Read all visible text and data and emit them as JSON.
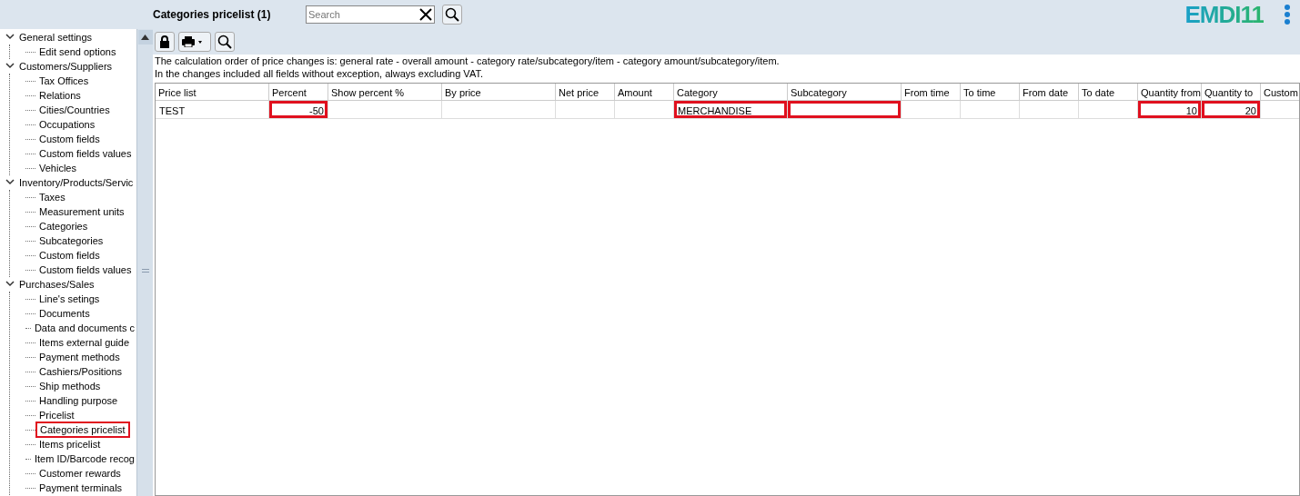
{
  "header": {
    "title": "Categories pricelist (1)",
    "search": {
      "placeholder": "Search"
    },
    "logo": "EMDI11"
  },
  "tree": [
    {
      "label": "General settings",
      "expanded": true,
      "children": [
        {
          "label": "Edit send options",
          "highlighted": false
        }
      ]
    },
    {
      "label": "Customers/Suppliers",
      "expanded": true,
      "children": [
        {
          "label": "Tax Offices",
          "highlighted": false
        },
        {
          "label": "Relations",
          "highlighted": false
        },
        {
          "label": "Cities/Countries",
          "highlighted": false
        },
        {
          "label": "Occupations",
          "highlighted": false
        },
        {
          "label": "Custom fields",
          "highlighted": false
        },
        {
          "label": "Custom fields values",
          "highlighted": false
        },
        {
          "label": "Vehicles",
          "highlighted": false
        }
      ]
    },
    {
      "label": "Inventory/Products/Servic",
      "expanded": true,
      "children": [
        {
          "label": "Taxes",
          "highlighted": false
        },
        {
          "label": "Measurement units",
          "highlighted": false
        },
        {
          "label": "Categories",
          "highlighted": false
        },
        {
          "label": "Subcategories",
          "highlighted": false
        },
        {
          "label": "Custom fields",
          "highlighted": false
        },
        {
          "label": "Custom fields values",
          "highlighted": false
        }
      ]
    },
    {
      "label": "Purchases/Sales",
      "expanded": true,
      "children": [
        {
          "label": "Line's setings",
          "highlighted": false
        },
        {
          "label": "Documents",
          "highlighted": false
        },
        {
          "label": "Data and documents c",
          "highlighted": false
        },
        {
          "label": "Items external guide",
          "highlighted": false
        },
        {
          "label": "Payment methods",
          "highlighted": false
        },
        {
          "label": "Cashiers/Positions",
          "highlighted": false
        },
        {
          "label": "Ship methods",
          "highlighted": false
        },
        {
          "label": "Handling purpose",
          "highlighted": false
        },
        {
          "label": "Pricelist",
          "highlighted": false
        },
        {
          "label": "Categories pricelist",
          "highlighted": true
        },
        {
          "label": "Items pricelist",
          "highlighted": false
        },
        {
          "label": "Item ID/Barcode recog",
          "highlighted": false
        },
        {
          "label": "Customer rewards",
          "highlighted": false
        },
        {
          "label": "Payment terminals",
          "highlighted": false
        }
      ]
    }
  ],
  "notes": [
    "The calculation order of price changes  is: general rate - overall amount - category rate/subcategory/item - category amount/subcategory/item.",
    "In the changes included all fields without exception, always excluding VAT."
  ],
  "table": {
    "columns": [
      {
        "label": "Price list",
        "kind": "text"
      },
      {
        "label": "Percent",
        "kind": "number"
      },
      {
        "label": "Show percent %",
        "kind": "text"
      },
      {
        "label": "By price",
        "kind": "text"
      },
      {
        "label": "Net price",
        "kind": "text"
      },
      {
        "label": "Amount",
        "kind": "text"
      },
      {
        "label": "Category",
        "kind": "text"
      },
      {
        "label": "Subcategory",
        "kind": "text"
      },
      {
        "label": "From time",
        "kind": "text"
      },
      {
        "label": "To time",
        "kind": "text"
      },
      {
        "label": "From date",
        "kind": "text"
      },
      {
        "label": "To date",
        "kind": "text"
      },
      {
        "label": "Quantity from",
        "kind": "number"
      },
      {
        "label": "Quantity to",
        "kind": "number"
      },
      {
        "label": "Custom",
        "kind": "text"
      }
    ],
    "rows": [
      [
        {
          "text": "TEST",
          "highlighted": false
        },
        {
          "text": "-50",
          "highlighted": true
        },
        null,
        null,
        null,
        null,
        {
          "text": "MERCHANDISE",
          "highlighted": true
        },
        {
          "highlighted": true
        },
        null,
        null,
        null,
        null,
        {
          "text": "10",
          "highlighted": true
        },
        {
          "text": "20",
          "highlighted": true
        },
        null
      ]
    ]
  }
}
